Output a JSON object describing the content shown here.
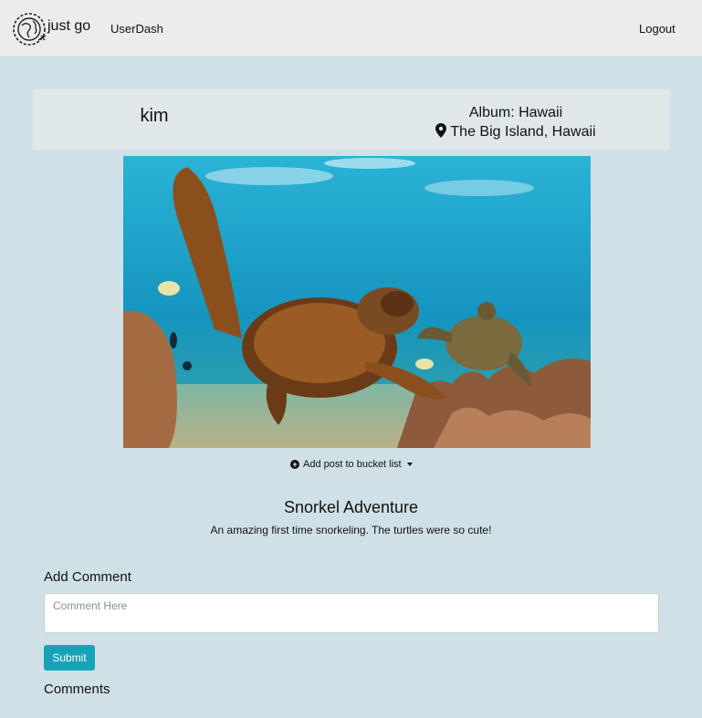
{
  "nav": {
    "brand": "just go",
    "userdash": "UserDash",
    "logout": "Logout"
  },
  "header": {
    "username": "kim",
    "album": "Album: Hawaii",
    "location": "The Big Island, Hawaii"
  },
  "post": {
    "bucket_label": "Add post to bucket list",
    "title": "Snorkel Adventure",
    "description": "An amazing first time snorkeling. The turtles were so cute!"
  },
  "comments": {
    "add_label": "Add Comment",
    "placeholder": "Comment Here",
    "submit_label": "Submit",
    "heading": "Comments"
  },
  "icons": {
    "logo": "globe-logo-icon",
    "location": "map-pin-icon",
    "bucket": "plus-circle-icon",
    "dropdown": "caret-down-icon"
  }
}
